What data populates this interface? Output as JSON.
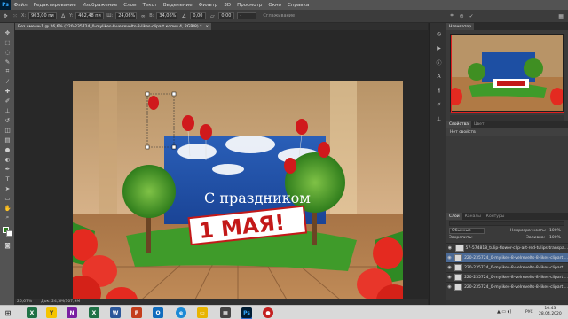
{
  "app": {
    "logo": "Ps"
  },
  "menu": [
    "Файл",
    "Редактирование",
    "Изображение",
    "Слои",
    "Текст",
    "Выделение",
    "Фильтр",
    "3D",
    "Просмотр",
    "Окно",
    "Справка"
  ],
  "options": {
    "x": "903,00 пи",
    "y": "462,48 пи",
    "w": "24,06%",
    "h": "34,06%",
    "angle": "0,00",
    "h_skew": "0,00",
    "interp": "-",
    "antialias_label": "Сглаживание"
  },
  "document_tab": "Без имени-1 @ 26,6% (220-235724_0-mylikes-8-velrevelts-8-likes-clipart копия 4, RGB/8) *",
  "status": {
    "zoom": "26,67%",
    "doc": "Док: 24,3M/307,9M"
  },
  "artwork": {
    "greeting_line1": "С праздником",
    "greeting_line2": "1 МАЯ!",
    "colors": {
      "sky": "#1d4fa3",
      "grass": "#3f9b2a",
      "banner": "#c31919",
      "wood": "#b07a45",
      "tulip": "#e42a20"
    }
  },
  "right_panels": {
    "navigator_tab": "Навигатор",
    "properties_tabs": [
      "Свойства",
      "Цвет"
    ],
    "properties_title": "Нет свойств",
    "layers_tabs": [
      "Слои",
      "Каналы",
      "Контуры"
    ],
    "blend_mode": "Обычные",
    "opacity_label": "Непрозрачность:",
    "opacity": "100%",
    "lock_label": "Закрепить:",
    "fill_label": "Заливка:",
    "fill": "100%",
    "layers": [
      {
        "name": "57-574818_tulip-flower-clip-art-red-tulips-transpa...",
        "selected": false
      },
      {
        "name": "220-235724_0-mylikes-8-velrevelts-8-likes-clipart ...",
        "selected": true
      },
      {
        "name": "220-235724_0-mylikes-8-velrevelts-8-likes-clipart ...",
        "selected": false
      },
      {
        "name": "220-235724_0-mylikes-8-velrevelts-8-likes-clipart ...",
        "selected": false
      },
      {
        "name": "220-235724_0-mylikes-8-velrevelts-8-likes-clipart ...",
        "selected": false
      }
    ]
  },
  "taskbar": {
    "lang": "РУС",
    "time": "10:43",
    "date": "28.04.2020"
  }
}
